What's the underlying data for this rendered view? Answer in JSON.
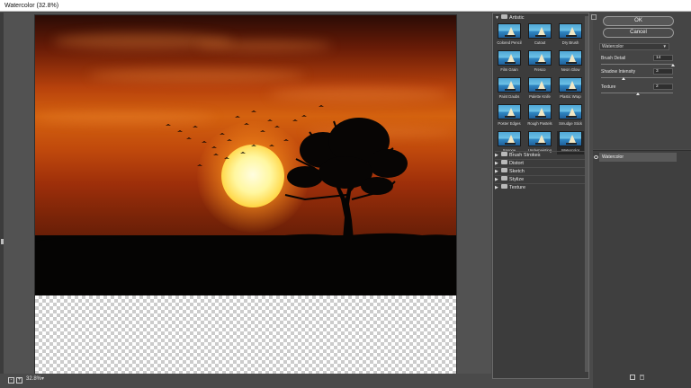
{
  "window": {
    "title": "Watercolor (32.8%)"
  },
  "status": {
    "zoom_level": "32.8%",
    "zoom_out_icon": "minus-square-icon",
    "zoom_in_icon": "plus-square-icon"
  },
  "buttons": {
    "ok": "OK",
    "cancel": "Cancel"
  },
  "gallery": {
    "open_category": "Artistic",
    "filters": [
      "Colored Pencil",
      "Cutout",
      "Dry Brush",
      "Film Grain",
      "Fresco",
      "Neon Glow",
      "Paint Daubs",
      "Palette Knife",
      "Plastic Wrap",
      "Poster Edges",
      "Rough Pastels",
      "Smudge Stick",
      "Sponge",
      "Underpainting",
      "Watercolor"
    ],
    "selected_filter": "Watercolor",
    "collapsed_categories": [
      "Brush Strokes",
      "Distort",
      "Sketch",
      "Stylize",
      "Texture"
    ]
  },
  "settings": {
    "filter_select": "Watercolor",
    "params": [
      {
        "label": "Brush Detail",
        "value": "14",
        "fraction": 1.0
      },
      {
        "label": "Shadow Intensity",
        "value": "3",
        "fraction": 0.3
      },
      {
        "label": "Texture",
        "value": "2",
        "fraction": 0.5
      }
    ]
  },
  "layers": {
    "items": [
      "Watercolor"
    ]
  },
  "colors": {
    "accent": "#4a4a4a",
    "panel": "#3c3c3c",
    "selected_thumb": "#262626"
  }
}
